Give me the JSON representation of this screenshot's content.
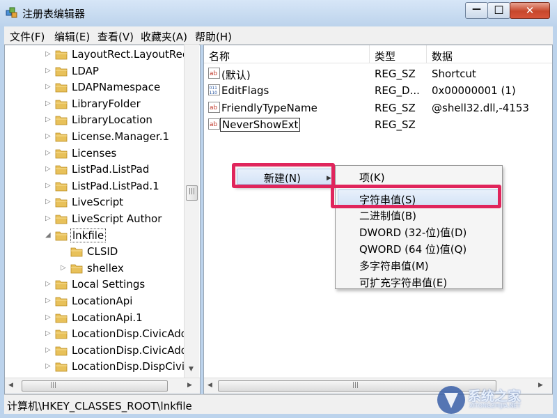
{
  "window": {
    "title": "注册表编辑器",
    "controls": {
      "minimize": "—",
      "maximize": "☐",
      "close": "✕"
    }
  },
  "menubar": [
    "文件(F)",
    "编辑(E)",
    "查看(V)",
    "收藏夹(A)",
    "帮助(H)"
  ],
  "tree": {
    "items": [
      {
        "label": "LayoutRect.LayoutRect",
        "expander": "▷"
      },
      {
        "label": "LDAP",
        "expander": "▷"
      },
      {
        "label": "LDAPNamespace",
        "expander": "▷"
      },
      {
        "label": "LibraryFolder",
        "expander": "▷"
      },
      {
        "label": "LibraryLocation",
        "expander": "▷"
      },
      {
        "label": "License.Manager.1",
        "expander": "▷"
      },
      {
        "label": "Licenses",
        "expander": "▷"
      },
      {
        "label": "ListPad.ListPad",
        "expander": "▷"
      },
      {
        "label": "ListPad.ListPad.1",
        "expander": "▷"
      },
      {
        "label": "LiveScript",
        "expander": "▷"
      },
      {
        "label": "LiveScript Author",
        "expander": "▷"
      },
      {
        "label": "lnkfile",
        "expander": "◢"
      },
      {
        "label": "CLSID",
        "expander": ""
      },
      {
        "label": "shellex",
        "expander": "▷"
      },
      {
        "label": "Local Settings",
        "expander": "▷"
      },
      {
        "label": "LocationApi",
        "expander": "▷"
      },
      {
        "label": "LocationApi.1",
        "expander": "▷"
      },
      {
        "label": "LocationDisp.CivicAddr",
        "expander": "▷"
      },
      {
        "label": "LocationDisp.CivicAddr",
        "expander": "▷"
      },
      {
        "label": "LocationDisp.DispCivic",
        "expander": "▷"
      }
    ],
    "scroll_down_arrow": "▼",
    "h_scroll_left": "◀",
    "h_scroll_right": "▶",
    "thumb_grip": "|||"
  },
  "list": {
    "columns": [
      "名称",
      "类型",
      "数据"
    ],
    "rows": [
      {
        "name": "(默认)",
        "type": "REG_SZ",
        "data": "Shortcut",
        "icon": "string-value-icon"
      },
      {
        "name": "EditFlags",
        "type": "REG_D...",
        "data": "0x00000001 (1)",
        "icon": "binary-value-icon"
      },
      {
        "name": "FriendlyTypeName",
        "type": "REG_SZ",
        "data": "@shell32.dll,-4153",
        "icon": "string-value-icon"
      },
      {
        "name": "NeverShowExt",
        "type": "REG_SZ",
        "data": "",
        "icon": "string-value-icon"
      }
    ],
    "h_scroll_left": "◀",
    "h_scroll_right": "▶",
    "thumb_grip": "|||"
  },
  "context_menu": {
    "parent_item": "新建(N)",
    "submenu_arrow": "▶",
    "submenu": [
      "项(K)",
      "字符串值(S)",
      "二进制值(B)",
      "DWORD (32-位)值(D)",
      "QWORD (64 位)值(Q)",
      "多字符串值(M)",
      "可扩充字符串值(E)"
    ]
  },
  "statusbar": {
    "path": "计算机\\HKEY_CLASSES_ROOT\\lnkfile"
  },
  "watermark": {
    "text": "系统之家",
    "sub": "XITONGZHIJIA.NET"
  },
  "colors": {
    "annotation": "#e0255c",
    "folder": "#e8c15a",
    "titlebar": "#bcd3ec",
    "highlight": "#d4e3f7"
  }
}
